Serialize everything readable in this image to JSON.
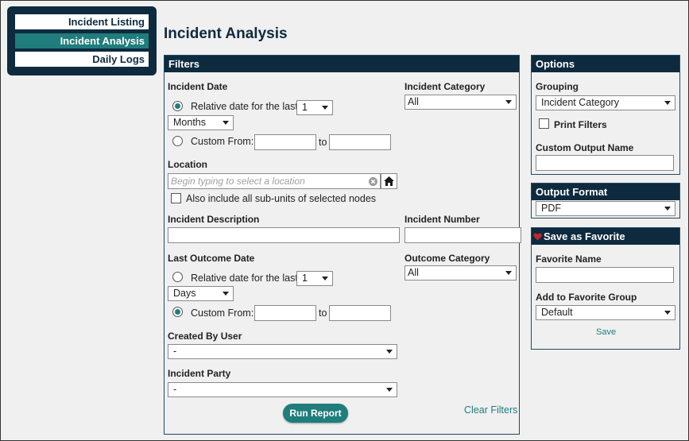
{
  "nav": {
    "items": [
      {
        "label": "Incident Listing"
      },
      {
        "label": "Incident Analysis",
        "active": true
      },
      {
        "label": "Daily Logs"
      }
    ]
  },
  "page": {
    "title": "Incident Analysis"
  },
  "filters": {
    "header": "Filters",
    "incident_date": {
      "label": "Incident Date",
      "relative_label": "Relative date for the last",
      "relative_checked": true,
      "count_value": "1",
      "unit_value": "Months",
      "custom_from_label": "Custom From:",
      "to_label": "to",
      "from_value": "",
      "to_value": ""
    },
    "incident_category": {
      "label": "Incident Category",
      "value": "All"
    },
    "location": {
      "label": "Location",
      "placeholder": "Begin typing to select a location",
      "include_subunits_label": "Also include all sub-units of selected nodes",
      "include_subunits_checked": false
    },
    "incident_description": {
      "label": "Incident Description",
      "value": ""
    },
    "incident_number": {
      "label": "Incident Number",
      "value": ""
    },
    "last_outcome_date": {
      "label": "Last Outcome Date",
      "relative_label": "Relative date for the last",
      "relative_checked": false,
      "count_value": "1",
      "unit_value": "Days",
      "custom_from_label": "Custom From:",
      "custom_checked": true,
      "to_label": "to",
      "from_value": "",
      "to_value": ""
    },
    "outcome_category": {
      "label": "Outcome Category",
      "value": "All"
    },
    "created_by_user": {
      "label": "Created By User",
      "value": "-"
    },
    "incident_party": {
      "label": "Incident Party",
      "value": "-"
    },
    "run_report_label": "Run Report",
    "clear_filters_label": "Clear Filters"
  },
  "options": {
    "header": "Options",
    "grouping_label": "Grouping",
    "grouping_value": "Incident Category",
    "print_filters_label": "Print Filters",
    "print_filters_checked": false,
    "custom_output_name_label": "Custom Output Name",
    "custom_output_name_value": ""
  },
  "output_format": {
    "header": "Output Format",
    "value": "PDF"
  },
  "favorite": {
    "header": "Save as Favorite",
    "name_label": "Favorite Name",
    "name_value": "",
    "group_label": "Add to Favorite Group",
    "group_value": "Default",
    "save_label": "Save"
  },
  "colors": {
    "navy": "#0e2a3f",
    "teal": "#1f7d7c",
    "heart": "#c0272d"
  },
  "icons": [
    "home-icon",
    "clear-icon",
    "heart-icon",
    "dropdown-arrow-icon"
  ]
}
